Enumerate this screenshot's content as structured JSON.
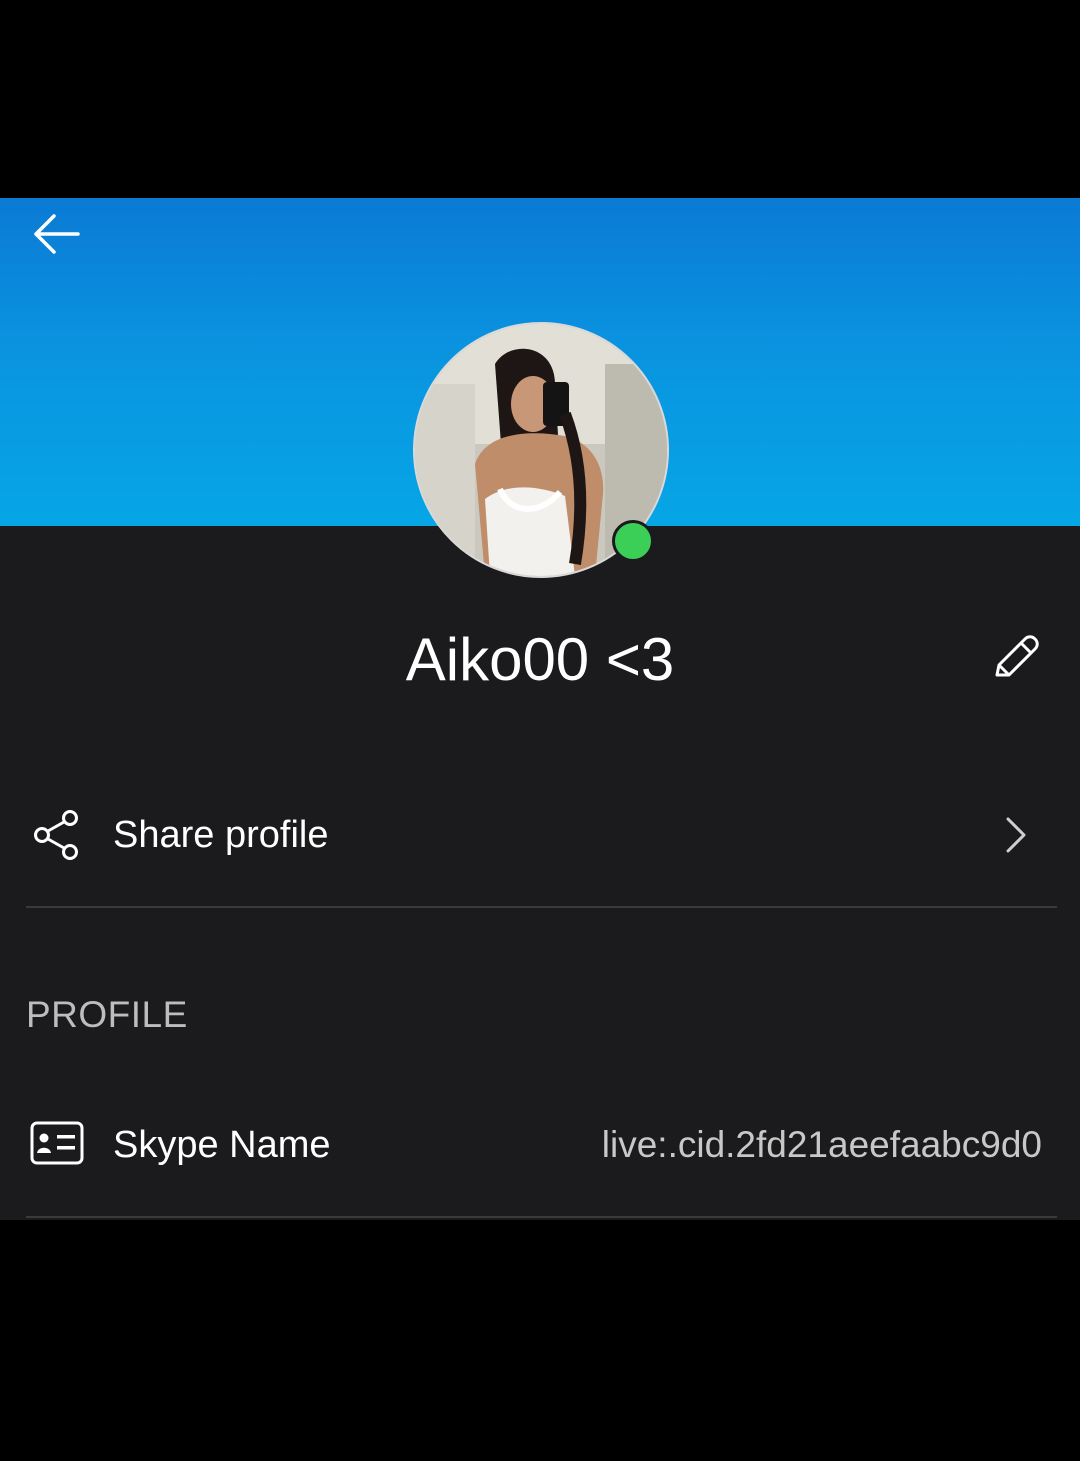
{
  "profile": {
    "display_name": "Aiko00 <3",
    "online_status": "online",
    "status_color": "#3ccf58"
  },
  "actions": {
    "share_label": "Share profile"
  },
  "section": {
    "profile_header": "PROFILE"
  },
  "fields": {
    "skype_name_label": "Skype Name",
    "skype_name_value": "live:.cid.2fd21aeefaabc9d0"
  },
  "icons": {
    "back": "arrow-left-icon",
    "edit": "pencil-icon",
    "share": "share-icon",
    "chevron": "chevron-right-icon",
    "id_card": "id-card-icon"
  },
  "colors": {
    "header_gradient_top": "#0b7ad4",
    "header_gradient_bottom": "#06a6e6",
    "background": "#1b1b1d"
  }
}
